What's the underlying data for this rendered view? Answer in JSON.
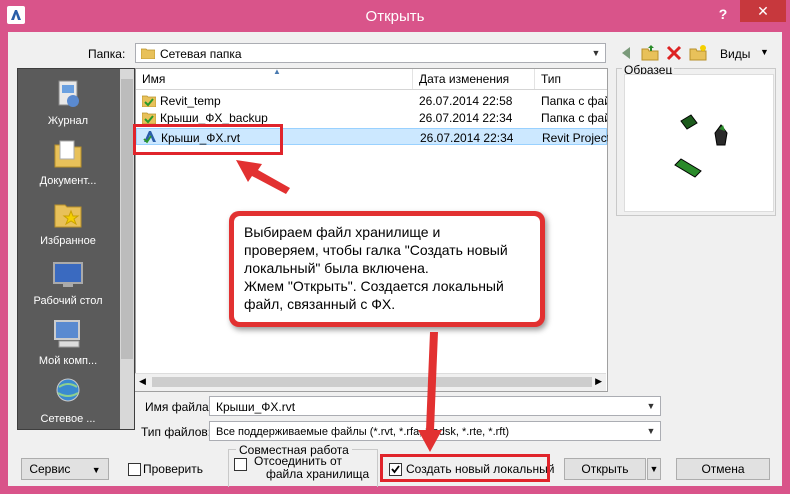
{
  "window": {
    "title": "Открыть",
    "help": "?",
    "close": "✕"
  },
  "folder": {
    "label": "Папка:",
    "value": "Сетевая папка",
    "views_label": "Виды"
  },
  "places": [
    {
      "label": "Журнал",
      "icon": "history-icon"
    },
    {
      "label": "Документ...",
      "icon": "documents-folder-icon"
    },
    {
      "label": "Избранное",
      "icon": "favorites-icon"
    },
    {
      "label": "Рабочий стол",
      "icon": "desktop-icon"
    },
    {
      "label": "Мой комп...",
      "icon": "computer-icon"
    },
    {
      "label": "Сетевое ...",
      "icon": "network-icon"
    }
  ],
  "columns": {
    "name": "Имя",
    "date": "Дата изменения",
    "type": "Тип"
  },
  "files": [
    {
      "name": "Revit_temp",
      "date": "26.07.2014 22:58",
      "type": "Папка с файл",
      "kind": "folder"
    },
    {
      "name": "Крыши_ФХ_backup",
      "date": "26.07.2014 22:34",
      "type": "Папка с файл",
      "kind": "folder"
    },
    {
      "name": "Крыши_ФХ.rvt",
      "date": "26.07.2014 22:34",
      "type": "Revit Project",
      "kind": "rvt",
      "selected": true
    }
  ],
  "preview": {
    "label": "Образец"
  },
  "callout": {
    "text_lines": [
      "Выбираем файл хранилище и",
      "проверяем, чтобы галка \"Создать новый",
      "локальный\" была включена.",
      "Жмем \"Открыть\". Создается локальный",
      "файл, связанный с ФХ."
    ]
  },
  "filename": {
    "label": "Имя файла:",
    "value": "Крыши_ФХ.rvt"
  },
  "filetype": {
    "label": "Тип файлов:",
    "value": "Все поддерживаемые файлы  (*.rvt, *.rfa, *.adsk, *.rte, *.rft)"
  },
  "worksharing": {
    "group_label": "Совместная работа",
    "detach_line1": "Отсоединить от",
    "detach_line2": "файла хранилища",
    "create_local": "Создать новый локальный",
    "create_local_checked": true,
    "detach_checked": false
  },
  "buttons": {
    "service": "Сервис",
    "verify": "Проверить",
    "open": "Открыть",
    "cancel": "Отмена"
  },
  "colors": {
    "highlight": "#e0242b",
    "title_bar": "#d9548a",
    "selection": "#cce8ff"
  }
}
